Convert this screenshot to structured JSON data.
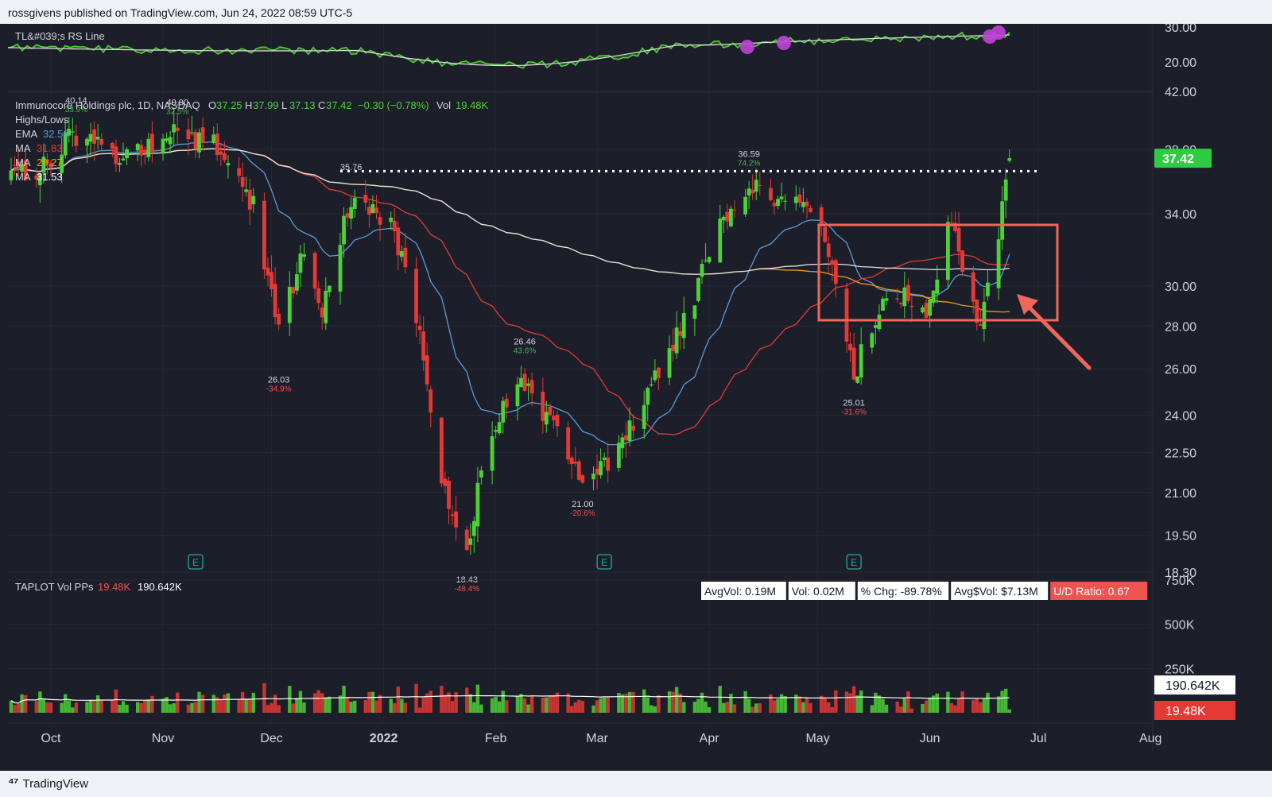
{
  "header": {
    "published": "rossgivens published on TradingView.com, Jun 24, 2022 08:59 UTC-5"
  },
  "footer": {
    "brand": "TradingView",
    "logo_glyph": "⁴⁷"
  },
  "rs_panel": {
    "label": "TL&#039;s RS Line",
    "axis_labels": [
      "30.00",
      "20.00"
    ]
  },
  "price_panel": {
    "title": "Immunocore Holdings plc, 1D, NASDAQ",
    "ohlc": {
      "o_label": "O",
      "o": "37.25",
      "h_label": "H",
      "h": "37.99",
      "l_label": "L",
      "l": "37.13",
      "c_label": "C",
      "c": "37.42",
      "chg": "−0.30 (−0.78%)",
      "vol_label": "Vol",
      "vol": "19.48K"
    },
    "legend": [
      {
        "name": "Highs/Lows",
        "value": "",
        "color": "#d1d4dc"
      },
      {
        "name": "EMA",
        "value": "32.56",
        "color": "#5b9bd5"
      },
      {
        "name": "MA",
        "value": "31.83",
        "color": "#e53935"
      },
      {
        "name": "MA",
        "value": "29.27",
        "color": "#f39c12"
      },
      {
        "name": "MA",
        "value": "31.53",
        "color": "#ffffff"
      }
    ],
    "axis_labels": [
      "42.00",
      "38.00",
      "34.00",
      "30.00",
      "28.00",
      "26.00",
      "24.00",
      "22.50",
      "21.00",
      "19.50",
      "18.30"
    ],
    "last_price": "37.42",
    "annotations": [
      {
        "price": "40.14",
        "pct": "33.9%",
        "kind": "high"
      },
      {
        "price": "40.00",
        "pct": "32.5%",
        "kind": "high"
      },
      {
        "price": "26.03",
        "pct": "-34.9%",
        "kind": "low"
      },
      {
        "price": "35.76",
        "pct": "",
        "kind": "high"
      },
      {
        "price": "18.43",
        "pct": "-48.4%",
        "kind": "low"
      },
      {
        "price": "26.46",
        "pct": "43.6%",
        "kind": "high"
      },
      {
        "price": "21.00",
        "pct": "-20.6%",
        "kind": "low"
      },
      {
        "price": "36.59",
        "pct": "74.2%",
        "kind": "high"
      },
      {
        "price": "25.01",
        "pct": "-31.6%",
        "kind": "low"
      }
    ],
    "earnings_marker": "E"
  },
  "volume_panel": {
    "label": "TAPLOT Vol PPs",
    "vol_red": "19.48K",
    "vol_avg": "190.642K",
    "stats": [
      {
        "text": "AvgVol: 0.19M",
        "bg": "#ffffff",
        "fg": "#131722"
      },
      {
        "text": "Vol: 0.02M",
        "bg": "#ffffff",
        "fg": "#131722"
      },
      {
        "text": "% Chg: -89.78%",
        "bg": "#ffffff",
        "fg": "#131722"
      },
      {
        "text": "Avg$Vol: $7.13M",
        "bg": "#ffffff",
        "fg": "#131722"
      },
      {
        "text": "U/D Ratio: 0.67",
        "bg": "#ef5350",
        "fg": "#ffffff"
      }
    ],
    "axis_labels": [
      "750K",
      "500K",
      "250K"
    ],
    "avg_badge": "190.642K",
    "vol_badge": "19.48K"
  },
  "time_axis": [
    "Oct",
    "Nov",
    "Dec",
    "2022",
    "Feb",
    "Mar",
    "Apr",
    "May",
    "Jun",
    "Jul",
    "Aug"
  ],
  "colors": {
    "up": "#4cd137",
    "down": "#e53935",
    "bg": "#1c1f2a",
    "box": "#f0665a",
    "arrow": "#f0665a"
  },
  "chart_data": {
    "type": "candlestick",
    "title": "Immunocore Holdings plc, 1D, NASDAQ",
    "ylim": [
      18.3,
      42
    ],
    "y_scale": "log",
    "resistance_line": 36.59,
    "points": [
      {
        "x": "2021-09-24",
        "y": 37.0
      },
      {
        "x": "2021-10-08",
        "y": 40.14
      },
      {
        "x": "2021-11-05",
        "y": 40.0
      },
      {
        "x": "2021-12-03",
        "y": 26.03
      },
      {
        "x": "2021-12-23",
        "y": 35.76
      },
      {
        "x": "2022-01-24",
        "y": 18.43
      },
      {
        "x": "2022-02-09",
        "y": 26.46
      },
      {
        "x": "2022-02-25",
        "y": 21.0
      },
      {
        "x": "2022-04-12",
        "y": 36.59
      },
      {
        "x": "2022-05-11",
        "y": 25.01
      },
      {
        "x": "2022-06-23",
        "y": 37.42
      }
    ]
  }
}
